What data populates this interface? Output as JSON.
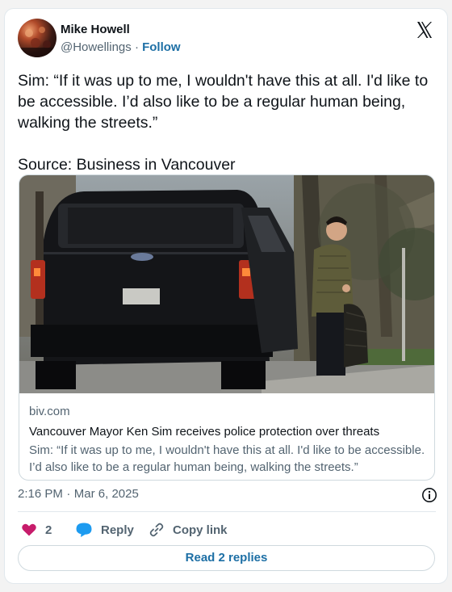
{
  "author": {
    "name": "Mike Howell",
    "handle": "@Howellings",
    "separator": "·",
    "follow_label": "Follow"
  },
  "tweet": {
    "text": "Sim: “If it was up to me, I wouldn't have this at all. I'd like to be accessible. I’d also like to be a regular human being, walking the streets.”\n\nSource: Business in Vancouver"
  },
  "link_card": {
    "domain": "biv.com",
    "title": "Vancouver Mayor Ken Sim receives police protection over threats",
    "description": "Sim: “If it was up to me, I wouldn't have this at all. I'd like to be accessible. I’d also like to be a regular human being, walking the streets.”",
    "photo_subject": "black SUV and man with bag"
  },
  "meta": {
    "time": "2:16 PM",
    "separator": "·",
    "date": "Mar 6, 2025"
  },
  "actions": {
    "like_count": "2",
    "reply_label": "Reply",
    "copy_label": "Copy link"
  },
  "read_replies": "Read 2 replies",
  "icons": {
    "platform": "x-logo-icon",
    "like": "heart-icon",
    "reply": "speech-bubble-icon",
    "copy": "link-icon",
    "info": "info-icon"
  },
  "colors": {
    "accent": "#1d6fa5",
    "like": "#c71c6b",
    "reply": "#1d9bf0",
    "muted": "#536471"
  }
}
